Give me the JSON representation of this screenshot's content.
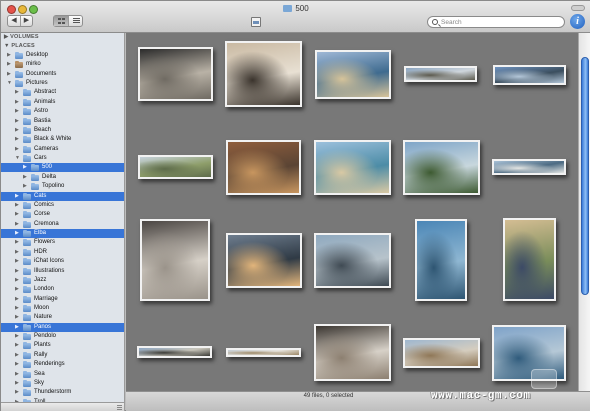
{
  "window": {
    "title": "500"
  },
  "toolbar": {
    "back_glyph": "◀",
    "forward_glyph": "▶",
    "search_placeholder": "Search",
    "info_glyph": "i"
  },
  "sidebar": {
    "volumes_label": "VOLUMES",
    "places_label": "PLACES",
    "items": [
      {
        "label": "Desktop",
        "disc": "▶",
        "icon": "folder-icon"
      },
      {
        "label": "mirko",
        "disc": "▶",
        "icon": "home-icon"
      },
      {
        "label": "Documents",
        "disc": "▶",
        "icon": "folder-icon"
      },
      {
        "label": "Pictures",
        "disc": "▼",
        "icon": "folder-icon"
      },
      {
        "label": "Abstract",
        "disc": "▶",
        "icon": "folder-icon"
      },
      {
        "label": "Animals",
        "disc": "▶",
        "icon": "folder-icon"
      },
      {
        "label": "Astro",
        "disc": "▶",
        "icon": "folder-icon"
      },
      {
        "label": "Bastia",
        "disc": "▶",
        "icon": "folder-icon"
      },
      {
        "label": "Beach",
        "disc": "▶",
        "icon": "folder-icon"
      },
      {
        "label": "Black & White",
        "disc": "▶",
        "icon": "folder-icon"
      },
      {
        "label": "Cameras",
        "disc": "▶",
        "icon": "folder-icon"
      },
      {
        "label": "Cars",
        "disc": "▼",
        "icon": "folder-icon"
      },
      {
        "label": "500",
        "disc": "▶",
        "icon": "folder-icon",
        "selected": true
      },
      {
        "label": "Delta",
        "disc": "▶",
        "icon": "folder-icon"
      },
      {
        "label": "Topolino",
        "disc": "▶",
        "icon": "folder-icon"
      },
      {
        "label": "Cats",
        "disc": "▶",
        "icon": "folder-icon",
        "selected": true
      },
      {
        "label": "Comics",
        "disc": "▶",
        "icon": "folder-icon"
      },
      {
        "label": "Corse",
        "disc": "▶",
        "icon": "folder-icon"
      },
      {
        "label": "Cremona",
        "disc": "▶",
        "icon": "folder-icon"
      },
      {
        "label": "Elba",
        "disc": "▶",
        "icon": "folder-icon",
        "selected": true
      },
      {
        "label": "Flowers",
        "disc": "▶",
        "icon": "folder-icon"
      },
      {
        "label": "HDR",
        "disc": "▶",
        "icon": "folder-icon"
      },
      {
        "label": "iChat Icons",
        "disc": "▶",
        "icon": "folder-icon"
      },
      {
        "label": "Illustrations",
        "disc": "▶",
        "icon": "folder-icon"
      },
      {
        "label": "Jazz",
        "disc": "▶",
        "icon": "folder-icon"
      },
      {
        "label": "London",
        "disc": "▶",
        "icon": "folder-icon"
      },
      {
        "label": "Marriage",
        "disc": "▶",
        "icon": "folder-icon"
      },
      {
        "label": "Moon",
        "disc": "▶",
        "icon": "folder-icon"
      },
      {
        "label": "Nature",
        "disc": "▶",
        "icon": "folder-icon"
      },
      {
        "label": "Panos",
        "disc": "▶",
        "icon": "folder-icon",
        "selected": true
      },
      {
        "label": "Pendolo",
        "disc": "▶",
        "icon": "folder-icon"
      },
      {
        "label": "Plants",
        "disc": "▶",
        "icon": "folder-icon"
      },
      {
        "label": "Rally",
        "disc": "▶",
        "icon": "folder-icon"
      },
      {
        "label": "Renderings",
        "disc": "▶",
        "icon": "folder-icon"
      },
      {
        "label": "Sea",
        "disc": "▶",
        "icon": "folder-icon"
      },
      {
        "label": "Sky",
        "disc": "▶",
        "icon": "folder-icon"
      },
      {
        "label": "Thunderstorm",
        "disc": "▶",
        "icon": "folder-icon"
      },
      {
        "label": "Troll",
        "disc": "▶",
        "icon": "folder-icon"
      }
    ]
  },
  "browser": {
    "thumbnails": [
      {
        "subject": "rocky shore",
        "colors": [
          "#2b2b2b",
          "#6f6a62",
          "#b9b2a6"
        ]
      },
      {
        "subject": "cat on tiles",
        "colors": [
          "#c9b9a2",
          "#3a332c",
          "#e8e0d3"
        ]
      },
      {
        "subject": "harbor lighthouse",
        "colors": [
          "#9fb8d6",
          "#d7c49a",
          "#3f6b8f"
        ]
      },
      {
        "subject": "panorama coastline",
        "colors": [
          "#8aa4bf",
          "#5c5a4e",
          "#cfd6dc"
        ]
      },
      {
        "subject": "panorama sea",
        "colors": [
          "#6f93c0",
          "#b3c6d8",
          "#3b4e5e"
        ]
      },
      {
        "subject": "panorama hills",
        "colors": [
          "#c7d3dd",
          "#5d6b4a",
          "#8e9e6a"
        ]
      },
      {
        "subject": "orange cat",
        "colors": [
          "#8f5e3d",
          "#c8965f",
          "#5a4434"
        ]
      },
      {
        "subject": "sandy beach",
        "colors": [
          "#9cc0dc",
          "#d9c9a4",
          "#4c8ca6"
        ]
      },
      {
        "subject": "green headland",
        "colors": [
          "#7fa5c8",
          "#3d5a31",
          "#c8d7dd"
        ]
      },
      {
        "subject": "panorama bay",
        "colors": [
          "#a9c1d6",
          "#e4e6e4",
          "#4d6b83"
        ]
      },
      {
        "subject": "car interior",
        "colors": [
          "#4b4643",
          "#9a938a",
          "#d6d0c7"
        ]
      },
      {
        "subject": "sunset sea",
        "colors": [
          "#6e7d8e",
          "#e2b57b",
          "#2f3a45"
        ]
      },
      {
        "subject": "rocky cove",
        "colors": [
          "#8fa9bf",
          "#3f4a53",
          "#b7c3cb"
        ]
      },
      {
        "subject": "cliff sea",
        "colors": [
          "#4b86b6",
          "#2e5572",
          "#8fb7d2"
        ]
      },
      {
        "subject": "blue fiat 500",
        "colors": [
          "#d4bd93",
          "#3c4a66",
          "#7a8d5a"
        ]
      },
      {
        "subject": "panorama town",
        "colors": [
          "#8fa8c4",
          "#3b3b36",
          "#c9c6bb"
        ]
      },
      {
        "subject": "panorama village",
        "colors": [
          "#c6cdd3",
          "#9c8866",
          "#e6e3dc"
        ]
      },
      {
        "subject": "splash water",
        "colors": [
          "#3b3631",
          "#8c7f70",
          "#d7d1c8"
        ]
      },
      {
        "subject": "old town",
        "colors": [
          "#9fb7cf",
          "#8f7757",
          "#d5cdbf"
        ]
      },
      {
        "subject": "coast road",
        "colors": [
          "#7fa3c9",
          "#2f5b7c",
          "#b5c8d6"
        ]
      }
    ]
  },
  "status": {
    "text": "49 files, 0 selected"
  },
  "watermark": {
    "text": "www.mac-gm.com"
  },
  "scroll": {
    "position": 0.2
  }
}
